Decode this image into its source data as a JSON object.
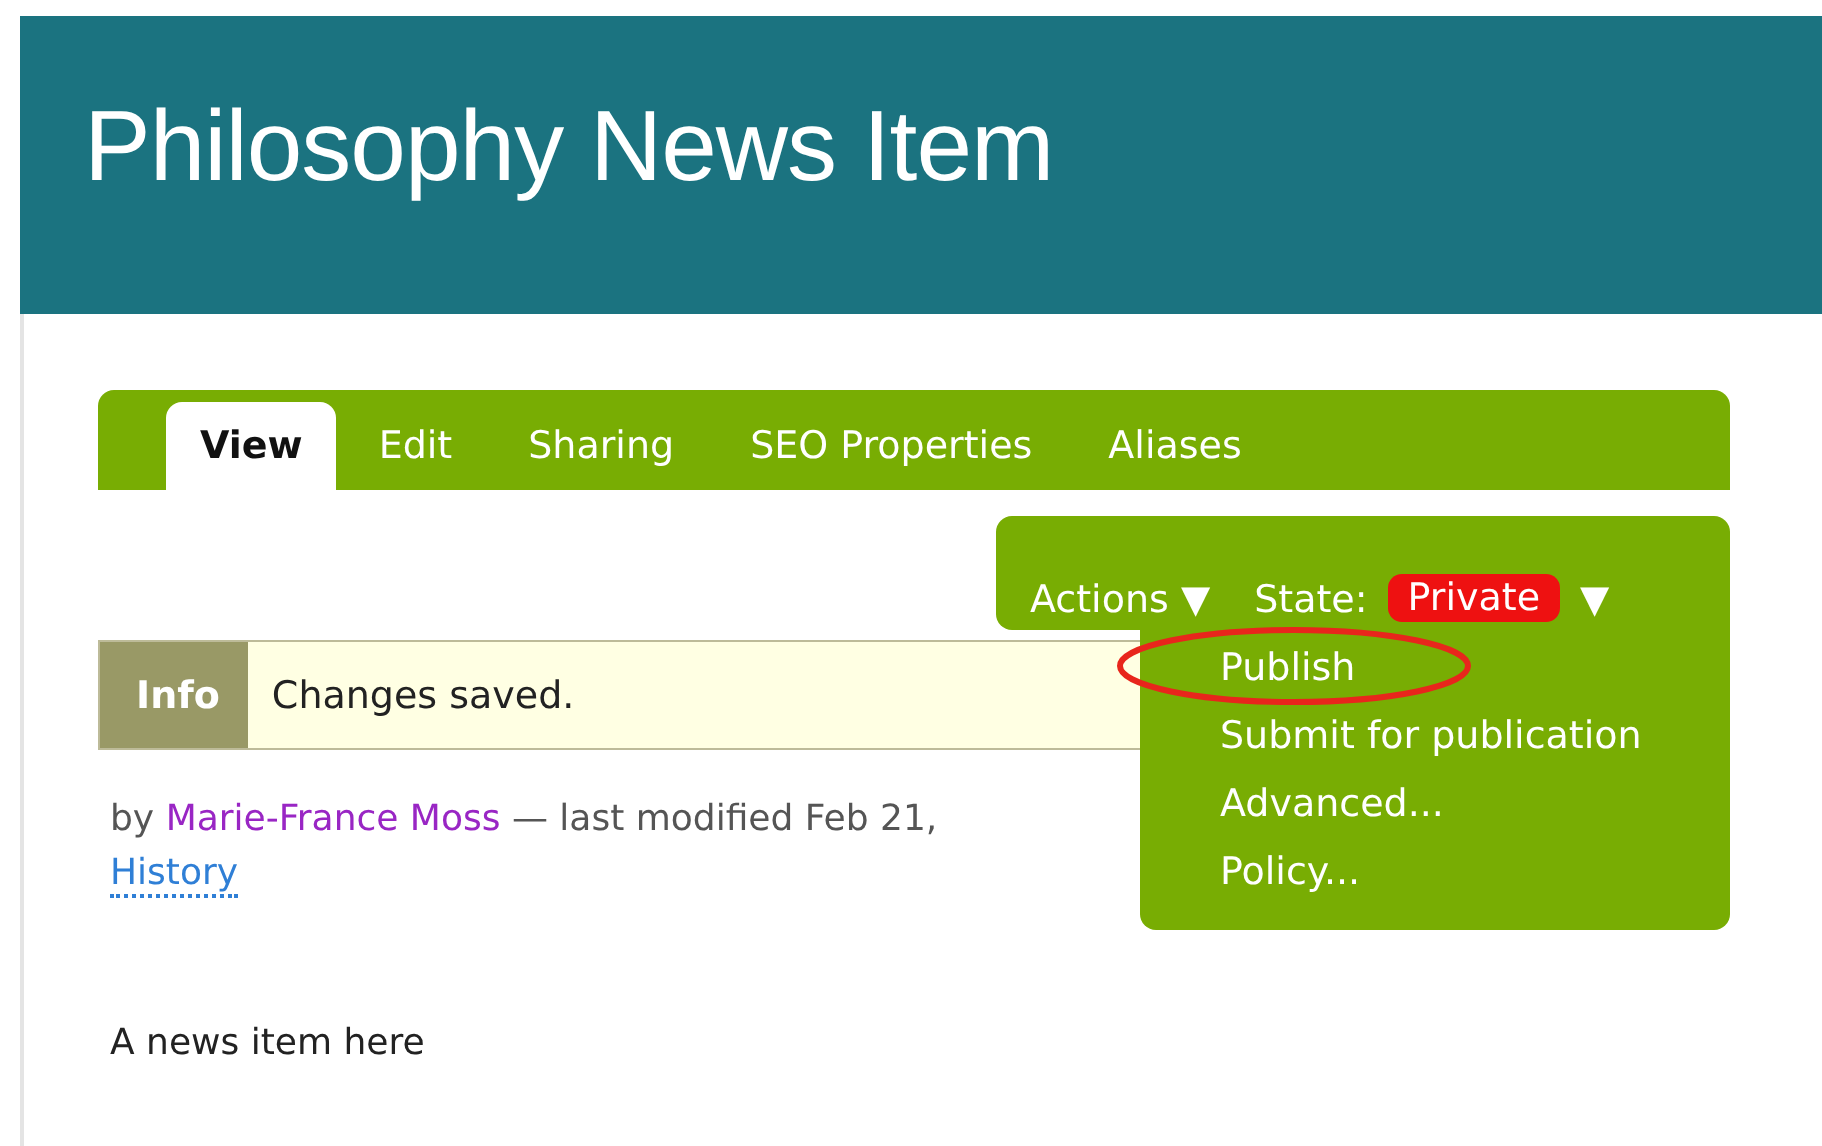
{
  "header": {
    "title": "Philosophy News Item"
  },
  "tabs": [
    {
      "label": "View",
      "selected": true
    },
    {
      "label": "Edit",
      "selected": false
    },
    {
      "label": "Sharing",
      "selected": false
    },
    {
      "label": "SEO Properties",
      "selected": false
    },
    {
      "label": "Aliases",
      "selected": false
    }
  ],
  "actions_bar": {
    "actions": {
      "label": "Actions",
      "caret": "▼"
    },
    "state_label": "State:",
    "state_value": "Private",
    "state_caret": "▼",
    "menu": [
      {
        "label": "Publish",
        "highlighted": true
      },
      {
        "label": "Submit for publication",
        "highlighted": false
      },
      {
        "label": "Advanced...",
        "highlighted": false
      },
      {
        "label": "Policy...",
        "highlighted": false
      }
    ]
  },
  "message": {
    "type": "Info",
    "text": "Changes saved."
  },
  "byline": {
    "prefix": "by",
    "author": "Marie-France Moss",
    "suffix": "— last modified Feb 21,",
    "history": "History"
  },
  "body_text": "A news item here"
}
